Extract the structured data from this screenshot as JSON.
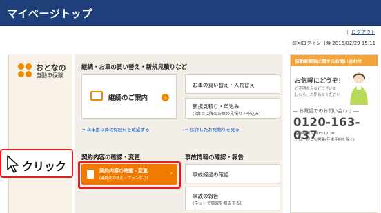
{
  "header": {
    "title": "マイページトップ"
  },
  "account": {
    "logout_label": "ログアウト",
    "last_login": "前回ログイン日時 2016/02/29 15:11"
  },
  "brand": {
    "line1": "おとなの",
    "line2": "自動車保険"
  },
  "renewal": {
    "heading": "継続・お車の買い替え・新規見積りなど",
    "guide_label": "継続のご案内",
    "replace_label": "お車の買い替え・入れ替え",
    "new_quote_label": "新規見積り・申込み",
    "new_quote_sub": "(2台目以降のお車の見積り・申込み)",
    "next_year_link": "次年度以降の保険料を確認する",
    "saved_quotes_link": "保存したお見積りを見る"
  },
  "contract": {
    "heading": "契約内容の確認・変更",
    "button_label": "契約内容の確認・変更",
    "button_sub": "(連絡先の修正・プランなど)"
  },
  "accident": {
    "heading": "事故情報の確認・報告",
    "progress_label": "事故経過の確認",
    "report_label": "事故の報告",
    "report_sub": "(ネットで事故を報告する)"
  },
  "callout": {
    "label": "クリック"
  },
  "contact": {
    "header": "自動車保険に関するお問い合わせ",
    "greeting": "お気軽にどうぞ！",
    "line1": "ご不明な点などございま",
    "line2": "したら、お問合せください",
    "phone_heading": "― お電話でのお問い合わせ ―",
    "phone": "0120-163-037",
    "hours1": "営業時間 9:00〜17:30",
    "hours2": "土日・祝日も営業(年末年始を除く)"
  }
}
